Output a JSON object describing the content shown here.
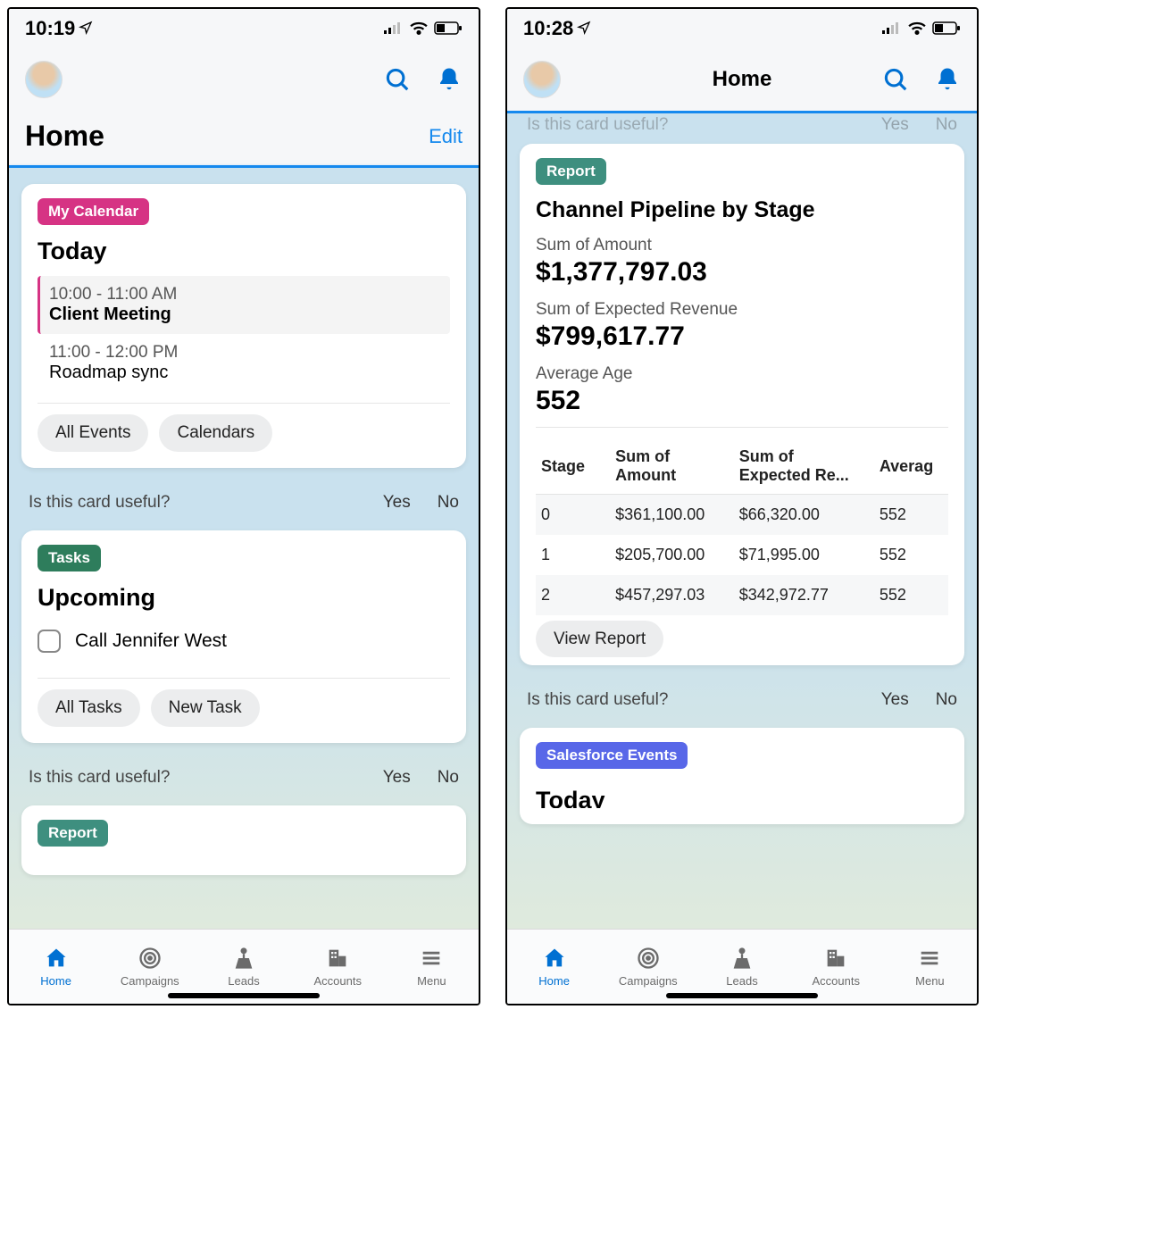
{
  "left": {
    "status_time": "10:19",
    "header_title": "Home",
    "edit_label": "Edit",
    "calendar": {
      "badge": "My Calendar",
      "heading": "Today",
      "events": [
        {
          "time": "10:00 - 11:00 AM",
          "title": "Client Meeting",
          "bold": true,
          "active": true
        },
        {
          "time": "11:00 - 12:00 PM",
          "title": "Roadmap sync",
          "bold": false,
          "active": false
        }
      ],
      "buttons": [
        "All Events",
        "Calendars"
      ]
    },
    "feedback": {
      "prompt": "Is this card useful?",
      "yes": "Yes",
      "no": "No"
    },
    "tasks": {
      "badge": "Tasks",
      "heading": "Upcoming",
      "items": [
        "Call Jennifer West"
      ],
      "buttons": [
        "All Tasks",
        "New Task"
      ]
    },
    "report_badge": "Report"
  },
  "right": {
    "status_time": "10:28",
    "header_title": "Home",
    "top_feedback_prompt": "Is this card useful?",
    "top_feedback_yes": "Yes",
    "top_feedback_no": "No",
    "report": {
      "badge": "Report",
      "title": "Channel Pipeline by Stage",
      "stats": [
        {
          "label": "Sum of Amount",
          "value": "$1,377,797.03"
        },
        {
          "label": "Sum of Expected Revenue",
          "value": "$799,617.77"
        },
        {
          "label": "Average Age",
          "value": "552"
        }
      ],
      "table": {
        "headers": [
          "Stage",
          "Sum of Amount",
          "Sum of Expected Re...",
          "Averag"
        ],
        "rows": [
          [
            "0",
            "$361,100.00",
            "$66,320.00",
            "552"
          ],
          [
            "1",
            "$205,700.00",
            "$71,995.00",
            "552"
          ],
          [
            "2",
            "$457,297.03",
            "$342,972.77",
            "552"
          ]
        ]
      },
      "view_button": "View Report"
    },
    "feedback": {
      "prompt": "Is this card useful?",
      "yes": "Yes",
      "no": "No"
    },
    "events_card": {
      "badge": "Salesforce Events",
      "heading": "Today"
    }
  },
  "tabs": [
    {
      "id": "home",
      "label": "Home"
    },
    {
      "id": "campaigns",
      "label": "Campaigns"
    },
    {
      "id": "leads",
      "label": "Leads"
    },
    {
      "id": "accounts",
      "label": "Accounts"
    },
    {
      "id": "menu",
      "label": "Menu"
    }
  ],
  "chart_data": {
    "type": "table",
    "title": "Channel Pipeline by Stage",
    "summary": {
      "Sum of Amount": 1377797.03,
      "Sum of Expected Revenue": 799617.77,
      "Average Age": 552
    },
    "columns": [
      "Stage",
      "Sum of Amount",
      "Sum of Expected Revenue",
      "Average Age"
    ],
    "rows": [
      {
        "Stage": 0,
        "Sum of Amount": 361100.0,
        "Sum of Expected Revenue": 66320.0,
        "Average Age": 552
      },
      {
        "Stage": 1,
        "Sum of Amount": 205700.0,
        "Sum of Expected Revenue": 71995.0,
        "Average Age": 552
      },
      {
        "Stage": 2,
        "Sum of Amount": 457297.03,
        "Sum of Expected Revenue": 342972.77,
        "Average Age": 552
      }
    ]
  }
}
